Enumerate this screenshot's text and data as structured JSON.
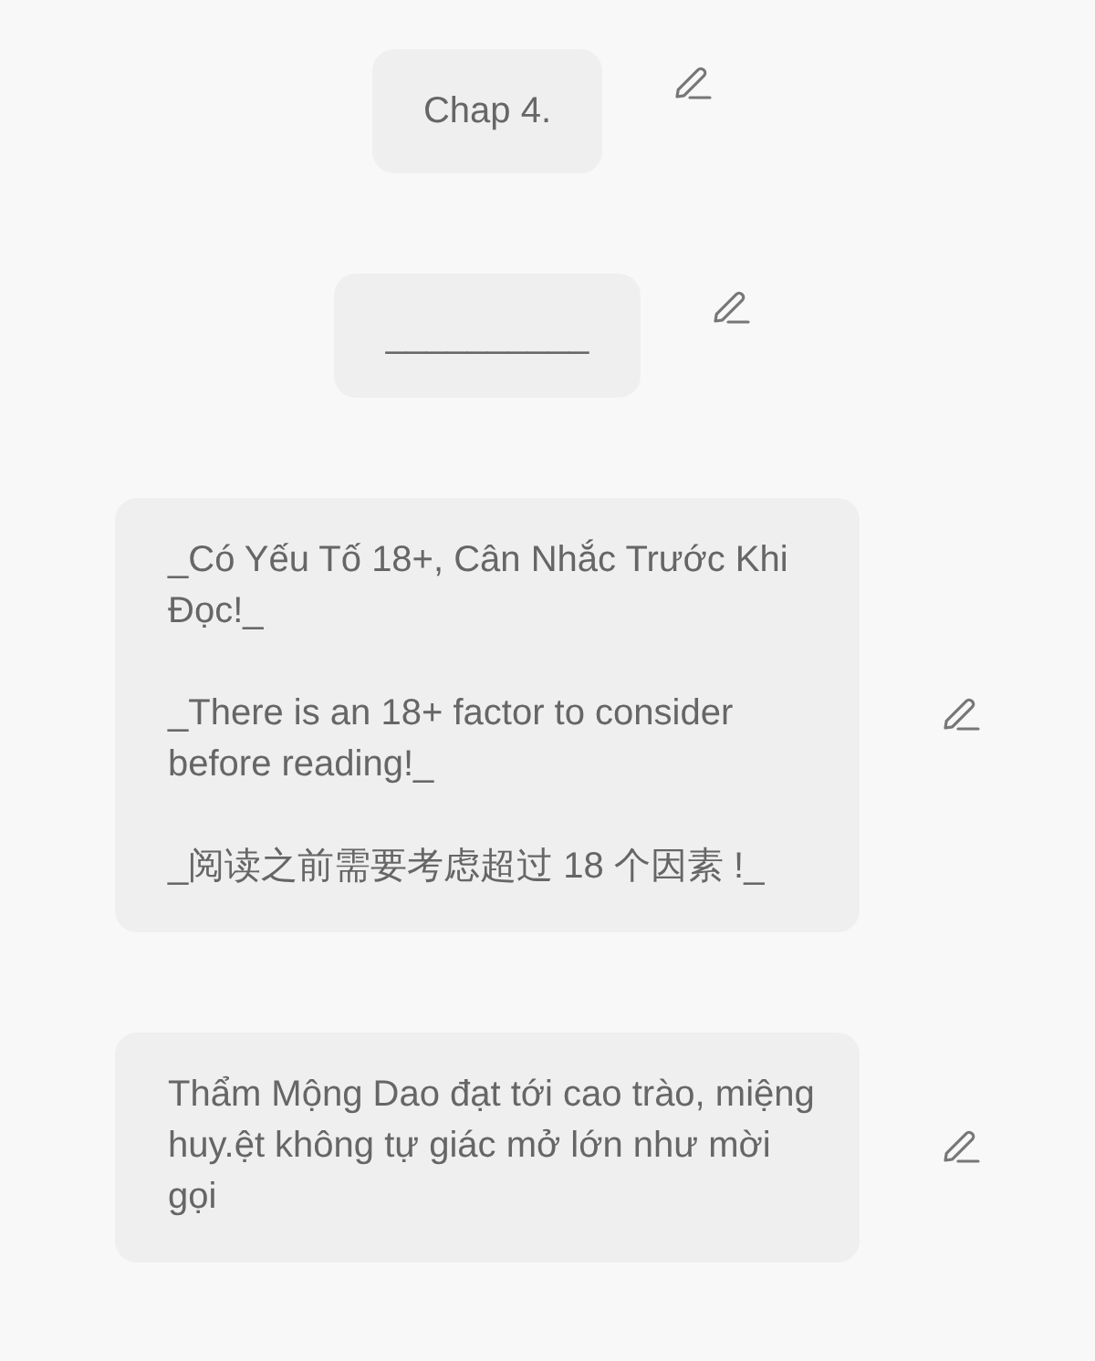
{
  "notes": [
    {
      "kind": "short",
      "text": "Chap 4."
    },
    {
      "kind": "short",
      "text": "__________"
    },
    {
      "kind": "long",
      "text": "_Có Yếu Tố 18+, Cân Nhắc Trước Khi Đọc!_\n\n_There is an 18+ factor to consider before reading!_\n\n_阅读之前需要考虑超过 18 个因素 !_"
    },
    {
      "kind": "long",
      "text": "Thẩm Mộng Dao đạt tới cao trào, miệng huy.ệt không tự giác mở lớn như mời gọi"
    }
  ]
}
